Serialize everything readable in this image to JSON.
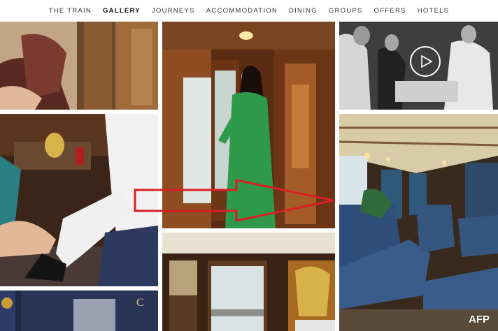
{
  "nav": {
    "items": [
      {
        "label": "THE TRAIN",
        "active": false
      },
      {
        "label": "GALLERY",
        "active": true
      },
      {
        "label": "JOURNEYS",
        "active": false
      },
      {
        "label": "ACCOMMODATION",
        "active": false
      },
      {
        "label": "DINING",
        "active": false
      },
      {
        "label": "GROUPS",
        "active": false
      },
      {
        "label": "OFFERS",
        "active": false
      },
      {
        "label": "HOTELS",
        "active": false
      }
    ]
  },
  "gallery": {
    "video_control": {
      "icon": "play-icon"
    },
    "annotation": {
      "shape": "arrow-right",
      "color": "#d91f26"
    }
  },
  "watermark": "AFP"
}
